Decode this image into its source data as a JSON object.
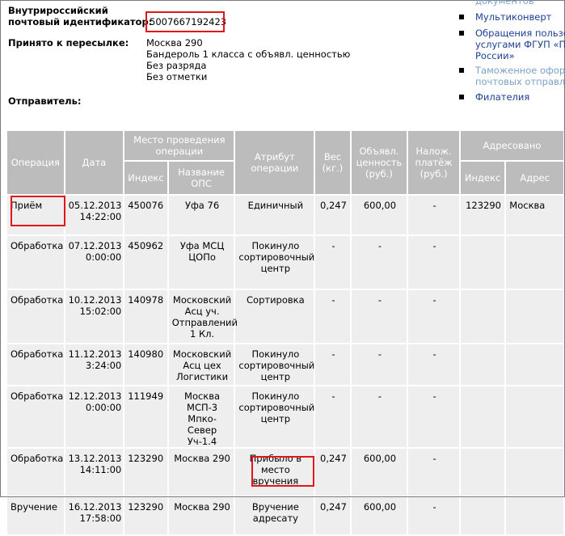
{
  "header": {
    "identifier_label_1": "Внутрироссийский",
    "identifier_label_2": "почтовый идентификатор:",
    "identifier_value": "50076671924​23",
    "accepted_label": "Принято к пересылке:",
    "accepted_lines": [
      "Москва 290",
      "Бандероль 1 класса с объявл. ценностью",
      "Без разряда",
      "Без отметки"
    ],
    "sender_label": "Отправитель:"
  },
  "right_links": [
    {
      "text": "документов",
      "gray": true
    },
    {
      "text": "Мультиконверт",
      "gray": false
    },
    {
      "text": "Обращения пользов",
      "gray": false
    },
    {
      "text": "услугами ФГУП «По",
      "gray": false
    },
    {
      "text": "России»",
      "gray": false
    },
    {
      "text": "Таможенное оформ",
      "gray": true
    },
    {
      "text": "почтовых отправле",
      "gray": true
    },
    {
      "text": "Филателия",
      "gray": false
    }
  ],
  "table": {
    "headers": {
      "operation": "Операция",
      "date": "Дата",
      "place": "Место проведения операции",
      "index": "Индекс",
      "ops_name": "Название ОПС",
      "attribute": "Атрибут операции",
      "weight": "Вес (кг.)",
      "declared": "Объявл. ценность (руб.)",
      "cod": "Налож. платёж (руб.)",
      "addressed": "Адресовано",
      "addr_index": "Индекс",
      "addr_address": "Адрес"
    },
    "rows": [
      {
        "op": "Приём",
        "date": "05.12.2013",
        "time": "14:22:00",
        "index": "450076",
        "name": [
          "Уфа 76"
        ],
        "attr": [
          "Единичный"
        ],
        "weight": "0,247",
        "value": "600,00",
        "cod": "-",
        "aindex": "123290",
        "address": "Москва"
      },
      {
        "op": "Обработка",
        "date": "07.12.2013",
        "time": "0:00:00",
        "index": "450962",
        "name": [
          "Уфа МСЦ",
          "ЦОПо"
        ],
        "attr": [
          "Покинуло",
          "сортировочный",
          "центр"
        ],
        "weight": "-",
        "value": "-",
        "cod": "-",
        "aindex": "",
        "address": ""
      },
      {
        "op": "Обработка",
        "date": "10.12.2013",
        "time": "15:02:00",
        "index": "140978",
        "name": [
          "Московский",
          "Асц уч.",
          "Отправлений",
          "1 Кл."
        ],
        "attr": [
          "Сортировка"
        ],
        "weight": "-",
        "value": "-",
        "cod": "-",
        "aindex": "",
        "address": ""
      },
      {
        "op": "Обработка",
        "date": "11.12.2013",
        "time": "3:24:00",
        "index": "140980",
        "name": [
          "Московский",
          "Асц цех",
          "Логистики"
        ],
        "attr": [
          "Покинуло",
          "сортировочный",
          "центр"
        ],
        "weight": "-",
        "value": "-",
        "cod": "-",
        "aindex": "",
        "address": ""
      },
      {
        "op": "Обработка",
        "date": "12.12.2013",
        "time": "0:00:00",
        "index": "111949",
        "name": [
          "Москва",
          "МСП-3 Мпко-",
          "Север Уч-1.4"
        ],
        "attr": [
          "Покинуло",
          "сортировочный",
          "центр"
        ],
        "weight": "-",
        "value": "-",
        "cod": "-",
        "aindex": "",
        "address": ""
      },
      {
        "op": "Обработка",
        "date": "13.12.2013",
        "time": "14:11:00",
        "index": "123290",
        "name": [
          "Москва 290"
        ],
        "attr": [
          "Прибыло в",
          "место",
          "вручения"
        ],
        "weight": "0,247",
        "value": "600,00",
        "cod": "-",
        "aindex": "",
        "address": ""
      },
      {
        "op": "Вручение",
        "date": "16.12.2013",
        "time": "17:58:00",
        "index": "123290",
        "name": [
          "Москва 290"
        ],
        "attr": [
          "Вручение",
          "адресату"
        ],
        "weight": "0,247",
        "value": "600,00",
        "cod": "-",
        "aindex": "",
        "address": ""
      }
    ]
  }
}
